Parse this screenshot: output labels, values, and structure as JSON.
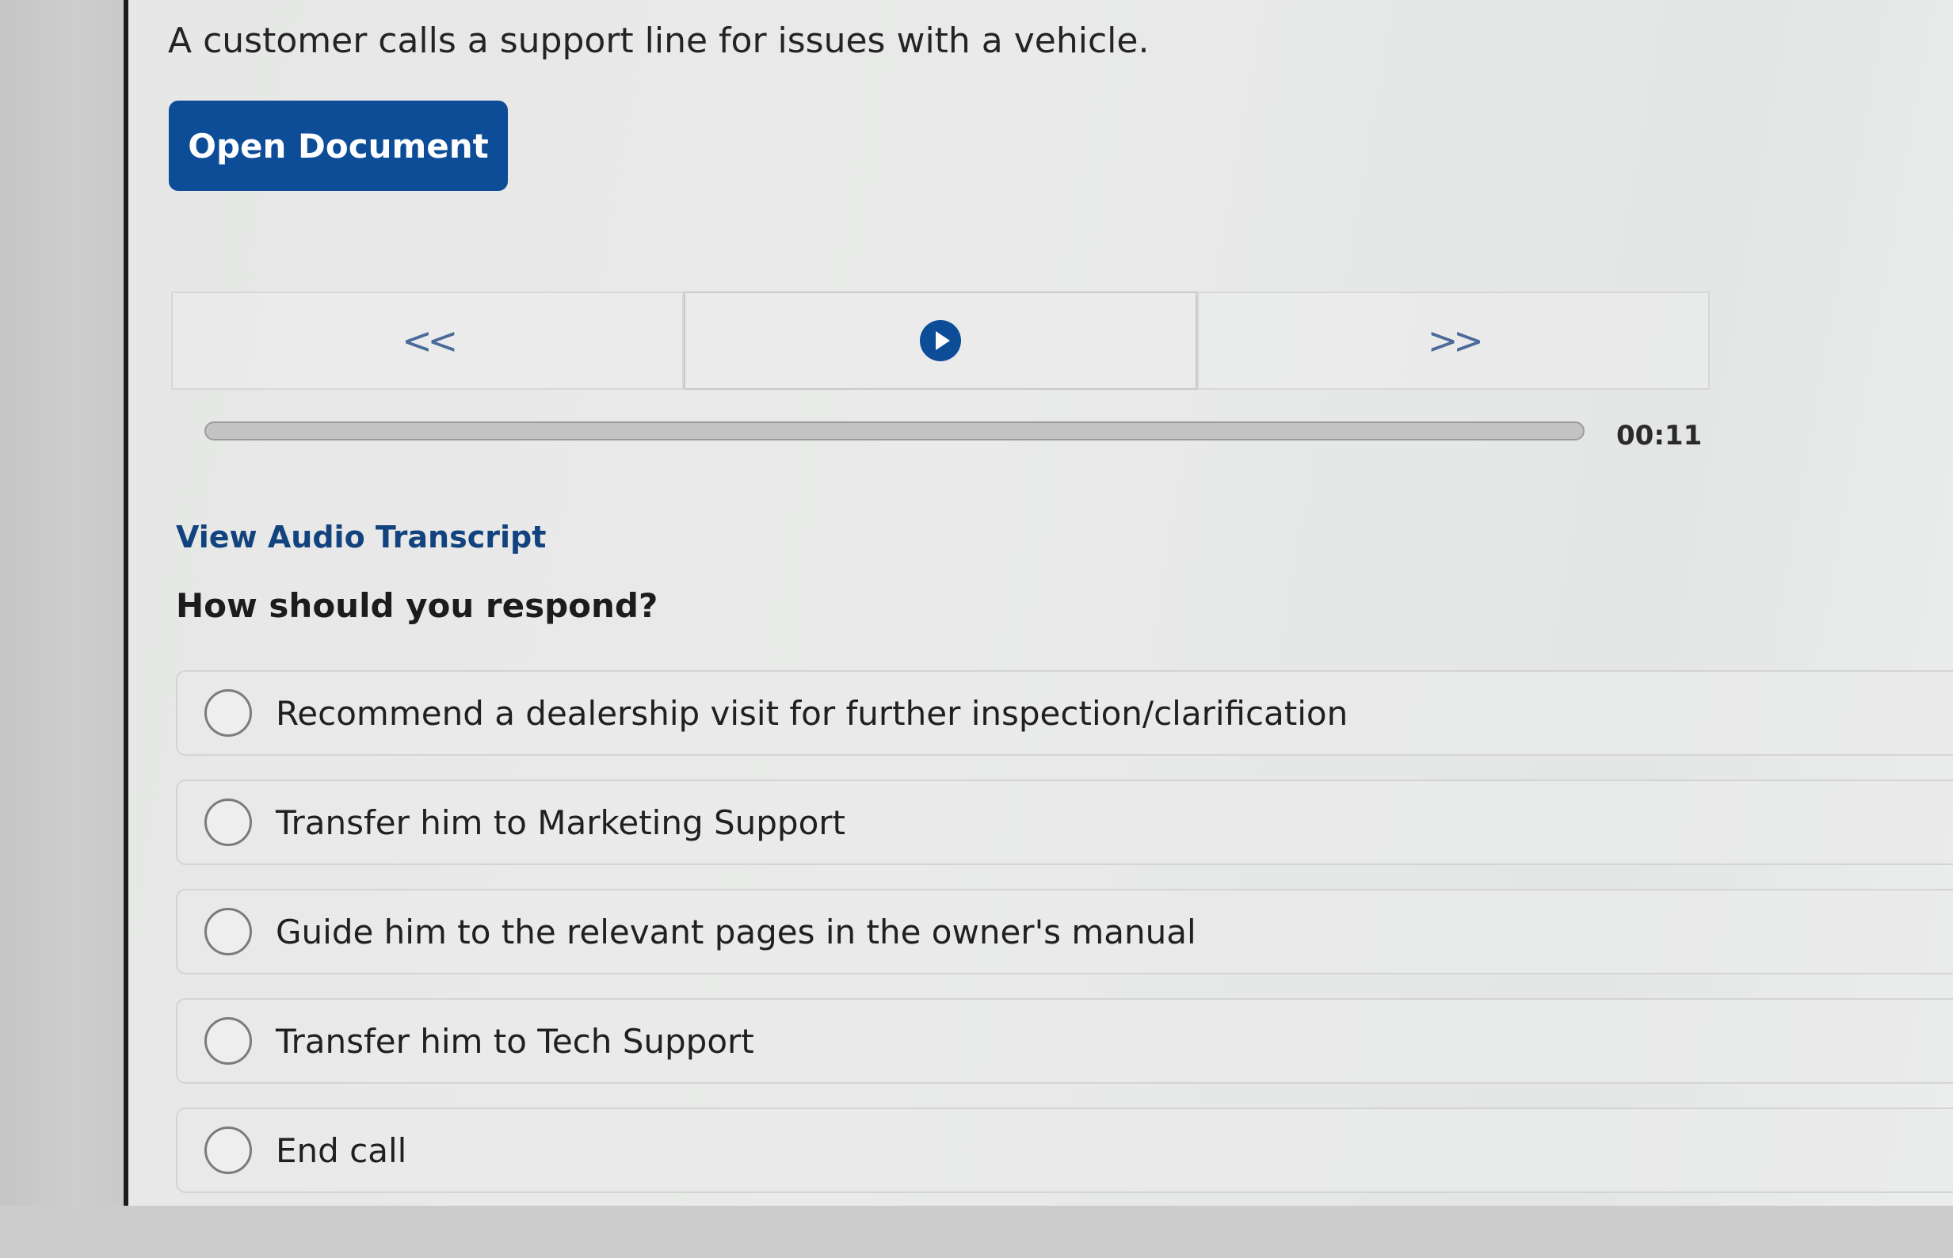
{
  "prompt": "A customer calls a support line for issues with a vehicle.",
  "open_document_label": "Open Document",
  "player": {
    "rewind_icon": "double-chevron-left-icon",
    "rewind_glyph": "<<",
    "play_icon": "play-circle-icon",
    "forward_icon": "double-chevron-right-icon",
    "forward_glyph": ">>",
    "time": "00:11",
    "progress_fraction": 0.0
  },
  "transcript_link": "View Audio Transcript",
  "question": "How should you respond?",
  "options": [
    {
      "label": "Recommend a dealership visit for further inspection/clarification"
    },
    {
      "label": "Transfer him to Marketing Support"
    },
    {
      "label": "Guide him to the relevant pages in the owner's manual"
    },
    {
      "label": "Transfer him to Tech Support"
    },
    {
      "label": "End call"
    }
  ],
  "colors": {
    "accent": "#0d4c97",
    "link": "#12437f"
  }
}
